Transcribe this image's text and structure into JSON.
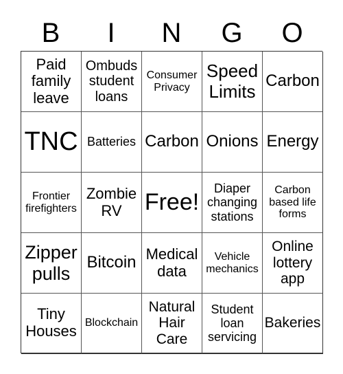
{
  "header": {
    "letters": [
      "B",
      "I",
      "N",
      "G",
      "O"
    ]
  },
  "cells": [
    [
      "Paid family leave",
      "Ombuds student loans",
      "Consumer Privacy",
      "Speed Limits",
      "Carbon"
    ],
    [
      "TNC",
      "Batteries",
      "Carbon",
      "Onions",
      "Energy"
    ],
    [
      "Frontier firefighters",
      "Zombie RV",
      "Free!",
      "Diaper changing stations",
      "Carbon based life forms"
    ],
    [
      "Zipper pulls",
      "Bitcoin",
      "Medical data",
      "Vehicle mechanics",
      "Online lottery app"
    ],
    [
      "Tiny Houses",
      "Blockchain",
      "Natural Hair Care",
      "Student loan servicing",
      "Bakeries"
    ]
  ]
}
